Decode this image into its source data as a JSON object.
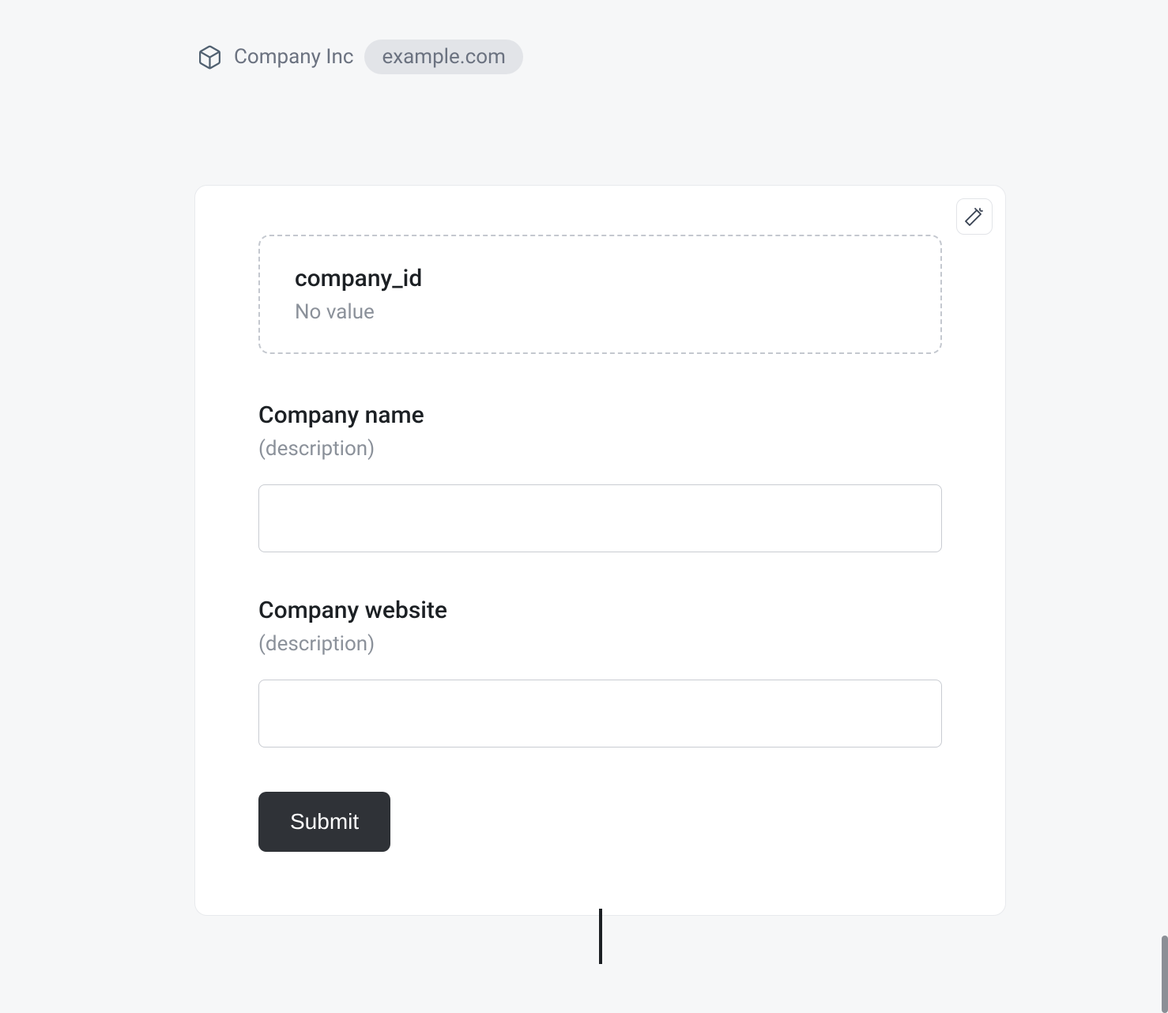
{
  "header": {
    "company_name": "Company Inc",
    "domain_chip": "example.com"
  },
  "card": {
    "hidden_field": {
      "label": "company_id",
      "value_text": "No value"
    },
    "fields": [
      {
        "label": "Company name",
        "description": "(description)",
        "value": ""
      },
      {
        "label": "Company website",
        "description": "(description)",
        "value": ""
      }
    ],
    "submit_label": "Submit"
  }
}
